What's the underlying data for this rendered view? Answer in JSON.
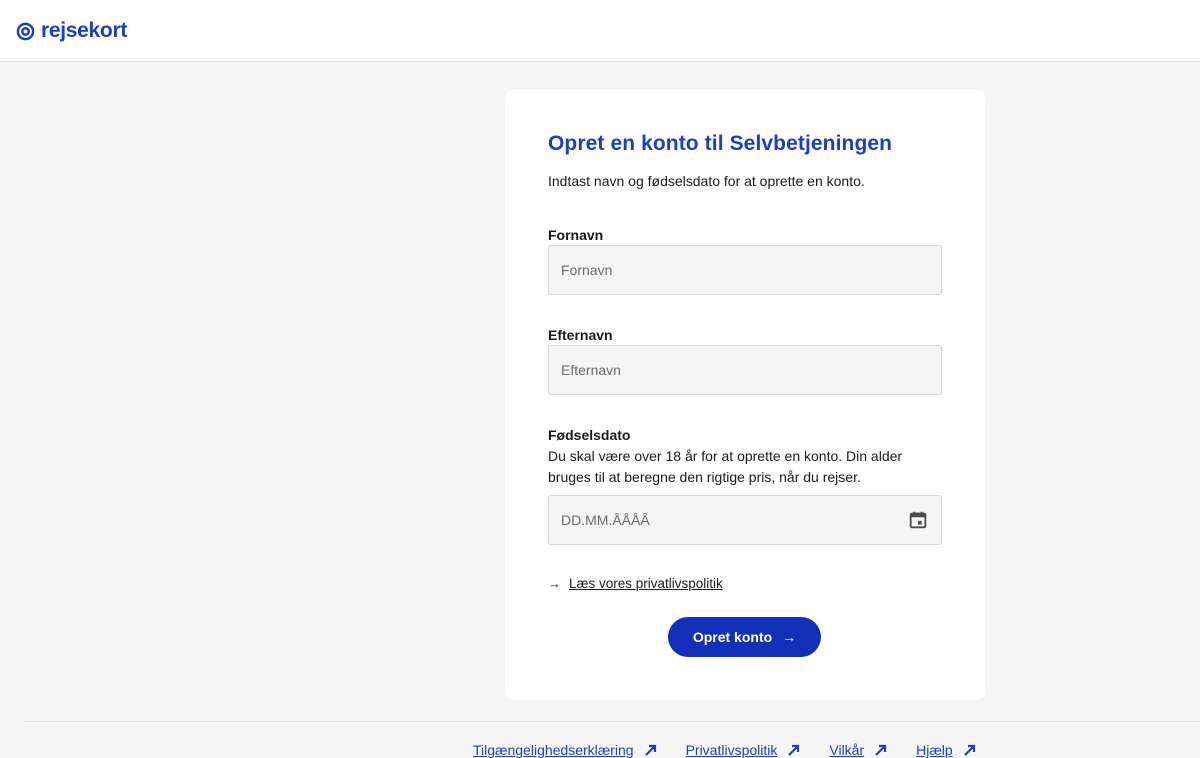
{
  "header": {
    "brand": "rejsekort",
    "brand_color": "#1a3fc4"
  },
  "form": {
    "title": "Opret en konto til Selvbetjeningen",
    "subtitle": "Indtast navn og fødselsdato for at oprette en konto.",
    "first_name": {
      "label": "Fornavn",
      "placeholder": "Fornavn",
      "value": ""
    },
    "last_name": {
      "label": "Efternavn",
      "placeholder": "Efternavn",
      "value": ""
    },
    "birthdate": {
      "label": "Fødselsdato",
      "help_line1": "Du skal være over 18 år for at oprette en konto. Din alder",
      "help_line2": "bruges til at beregne den rigtige pris, når du rejser.",
      "placeholder": "DD.MM.ÅÅÅÅ",
      "value": "",
      "icon": "calendar-icon"
    },
    "privacy_link": {
      "arrow": "→",
      "label": "Læs vores privatlivspolitik"
    },
    "submit": {
      "label": "Opret konto",
      "arrow": "→",
      "color": "#1530b8"
    }
  },
  "footer": {
    "links": [
      {
        "label": "Tilgængelighedserklæring",
        "icon": "external-link-icon"
      },
      {
        "label": "Privatlivspolitik",
        "icon": "external-link-icon"
      },
      {
        "label": "Vilkår",
        "icon": "external-link-icon"
      },
      {
        "label": "Hjælp",
        "icon": "external-link-icon"
      }
    ]
  }
}
